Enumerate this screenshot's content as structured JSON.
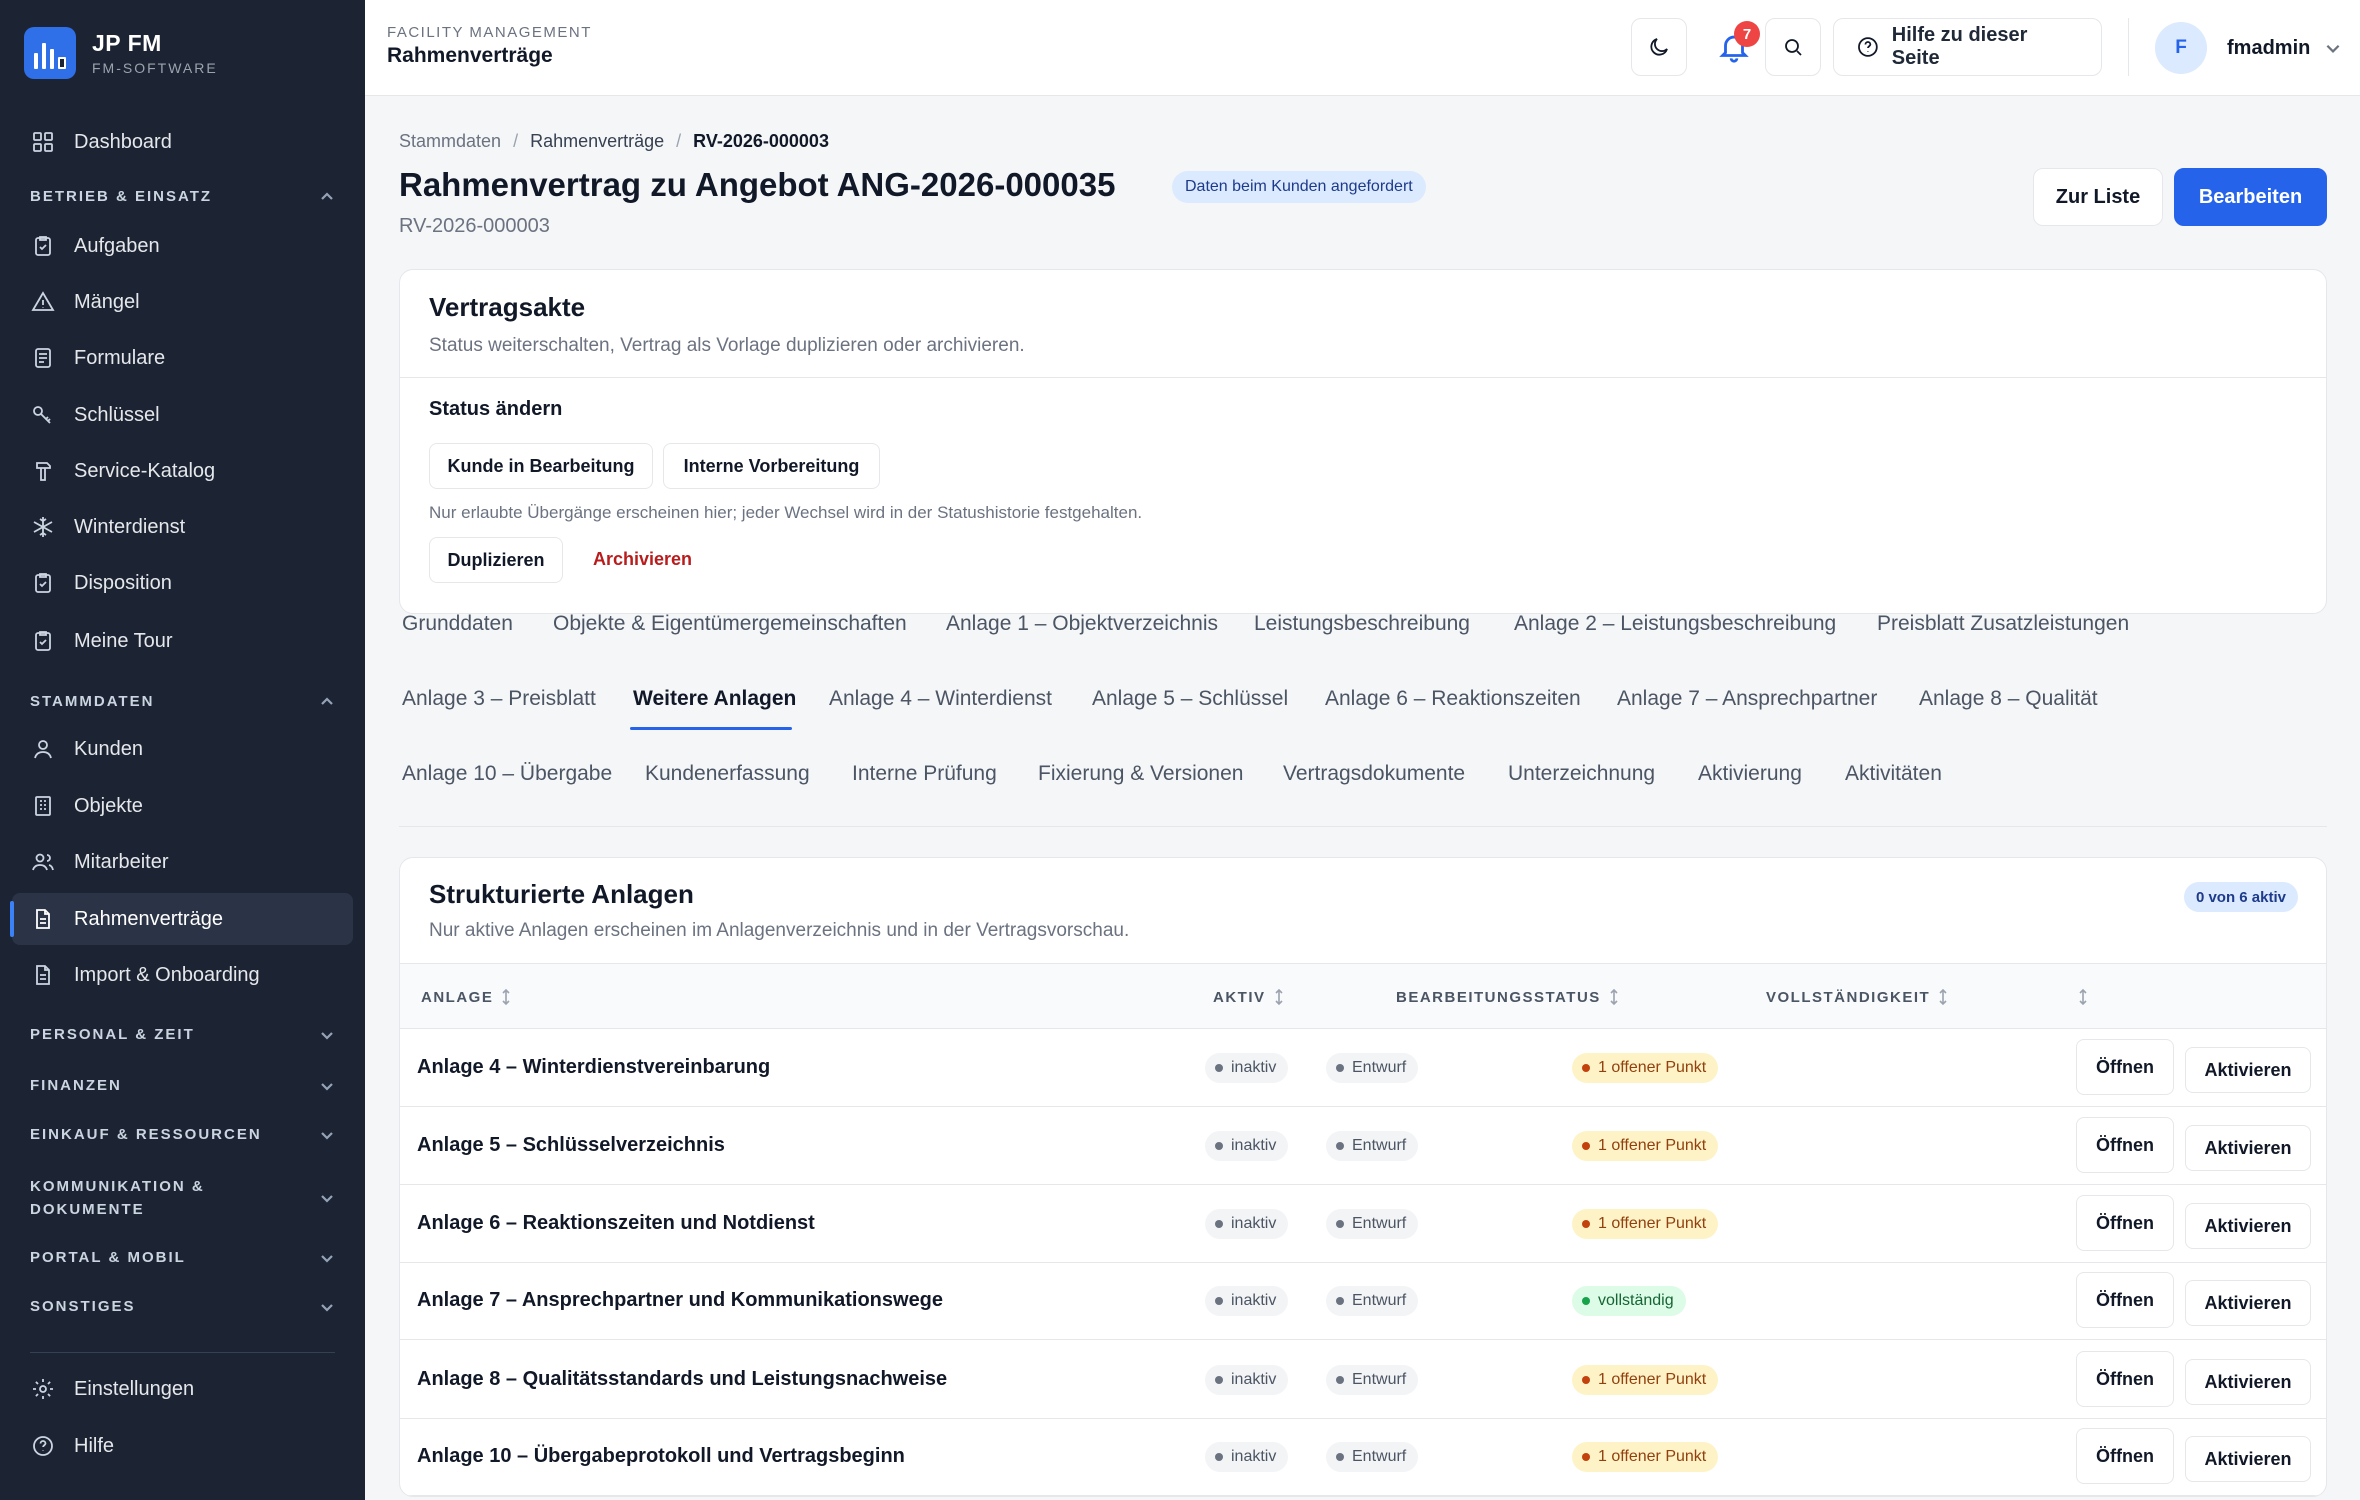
{
  "brand": {
    "title": "JP FM",
    "subtitle": "FM-SOFTWARE"
  },
  "sidebar": {
    "dashboard": "Dashboard",
    "section_betrieb": "BETRIEB & EINSATZ",
    "betrieb_items": [
      "Aufgaben",
      "Mängel",
      "Formulare",
      "Schlüssel",
      "Service-Katalog",
      "Winterdienst",
      "Disposition",
      "Meine Tour"
    ],
    "section_stammdaten": "STAMMDATEN",
    "stammdaten_items": [
      "Kunden",
      "Objekte",
      "Mitarbeiter",
      "Rahmenverträge",
      "Import & Onboarding"
    ],
    "collapsed_sections": [
      "PERSONAL & ZEIT",
      "FINANZEN",
      "EINKAUF & RESSOURCEN",
      "KOMMUNIKATION & DOKUMENTE",
      "PORTAL & MOBIL",
      "SONSTIGES"
    ],
    "settings": "Einstellungen",
    "help": "Hilfe"
  },
  "topbar": {
    "kicker": "FACILITY MANAGEMENT",
    "title": "Rahmenverträge",
    "notification_count": "7",
    "help_label": "Hilfe zu dieser Seite",
    "user_initial": "F",
    "user_name": "fmadmin"
  },
  "breadcrumb": [
    "Stammdaten",
    "Rahmenverträge",
    "RV-2026-000003"
  ],
  "page": {
    "title": "Rahmenvertrag zu Angebot ANG-2026-000035",
    "status_badge": "Daten beim Kunden angefordert",
    "subtitle": "RV-2026-000003",
    "btn_list": "Zur Liste",
    "btn_edit": "Bearbeiten"
  },
  "vertragsakte": {
    "title": "Vertragsakte",
    "desc": "Status weiterschalten, Vertrag als Vorlage duplizieren oder archivieren.",
    "status_heading": "Status ändern",
    "status_options": [
      "Kunde in Bearbeitung",
      "Interne Vorbereitung"
    ],
    "hint": "Nur erlaubte Übergänge erscheinen hier; jeder Wechsel wird in der Statushistorie festgehalten.",
    "btn_duplicate": "Duplizieren",
    "btn_archive": "Archivieren"
  },
  "tabs": {
    "row1": [
      "Grunddaten",
      "Objekte & Eigentümergemeinschaften",
      "Anlage 1 – Objektverzeichnis",
      "Leistungsbeschreibung",
      "Anlage 2 – Leistungsbeschreibung",
      "Preisblatt Zusatzleistungen"
    ],
    "row2": [
      "Anlage 3 – Preisblatt",
      "Weitere Anlagen",
      "Anlage 4 – Winterdienst",
      "Anlage 5 – Schlüssel",
      "Anlage 6 – Reaktionszeiten",
      "Anlage 7 – Ansprechpartner",
      "Anlage 8 – Qualität"
    ],
    "row3": [
      "Anlage 10 – Übergabe",
      "Kundenerfassung",
      "Interne Prüfung",
      "Fixierung & Versionen",
      "Vertragsdokumente",
      "Unterzeichnung",
      "Aktivierung",
      "Aktivitäten"
    ],
    "active": "Weitere Anlagen"
  },
  "anlagen": {
    "title": "Strukturierte Anlagen",
    "desc": "Nur aktive Anlagen erscheinen im Anlagenverzeichnis und in der Vertragsvorschau.",
    "count_badge": "0 von 6 aktiv",
    "columns": [
      "ANLAGE",
      "AKTIV",
      "BEARBEITUNGSSTATUS",
      "VOLLSTÄNDIGKEIT"
    ],
    "rows": [
      {
        "name": "Anlage 4 – Winterdienstvereinbarung",
        "aktiv": "inaktiv",
        "status": "Entwurf",
        "completeness": "1 offener Punkt",
        "complete": false,
        "open_label": "Öffnen",
        "activate_label": "Aktivieren"
      },
      {
        "name": "Anlage 5 – Schlüsselverzeichnis",
        "aktiv": "inaktiv",
        "status": "Entwurf",
        "completeness": "1 offener Punkt",
        "complete": false,
        "open_label": "Öffnen",
        "activate_label": "Aktivieren"
      },
      {
        "name": "Anlage 6 – Reaktionszeiten und Notdienst",
        "aktiv": "inaktiv",
        "status": "Entwurf",
        "completeness": "1 offener Punkt",
        "complete": false,
        "open_label": "Öffnen",
        "activate_label": "Aktivieren"
      },
      {
        "name": "Anlage 7 – Ansprechpartner und Kommunikationswege",
        "aktiv": "inaktiv",
        "status": "Entwurf",
        "completeness": "vollständig",
        "complete": true,
        "open_label": "Öffnen",
        "activate_label": "Aktivieren"
      },
      {
        "name": "Anlage 8 – Qualitätsstandards und Leistungsnachweise",
        "aktiv": "inaktiv",
        "status": "Entwurf",
        "completeness": "1 offener Punkt",
        "complete": false,
        "open_label": "Öffnen",
        "activate_label": "Aktivieren"
      },
      {
        "name": "Anlage 10 – Übergabeprotokoll und Vertragsbeginn",
        "aktiv": "inaktiv",
        "status": "Entwurf",
        "completeness": "1 offener Punkt",
        "complete": false,
        "open_label": "Öffnen",
        "activate_label": "Aktivieren"
      }
    ]
  },
  "colors": {
    "primary": "#2563eb",
    "sidebar_bg": "#1c2433",
    "danger": "#b91c1c",
    "badge_red": "#ef4444"
  }
}
